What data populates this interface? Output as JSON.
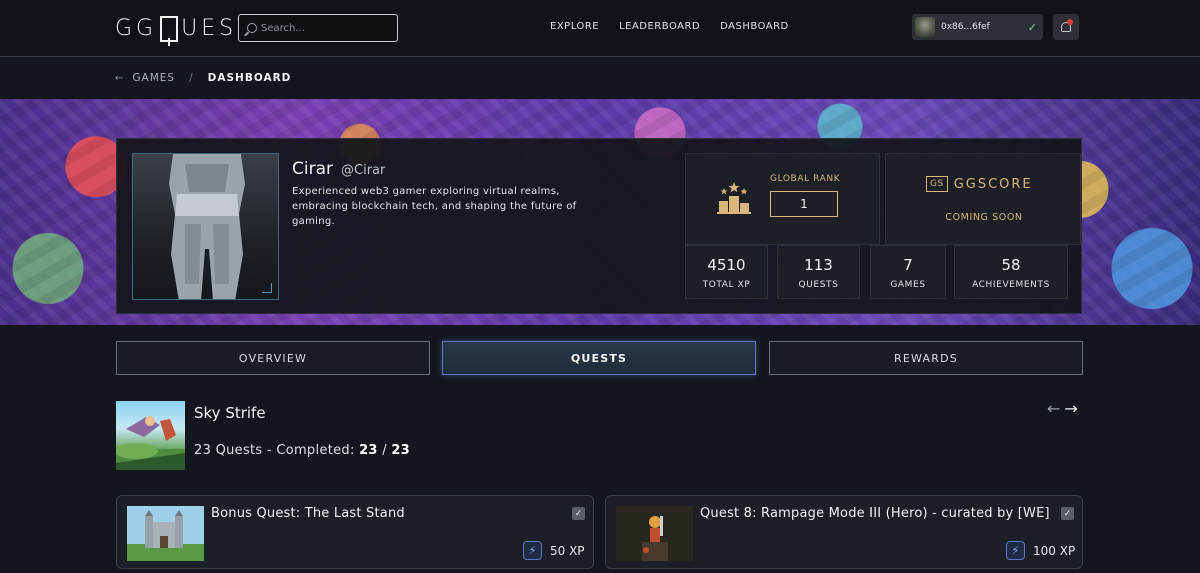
{
  "header": {
    "logo_left": "GG",
    "logo_right": "UEST",
    "search_placeholder": "Search...",
    "nav": [
      "EXPLORE",
      "LEADERBOARD",
      "DASHBOARD"
    ],
    "wallet_address": "0x86...6fef"
  },
  "breadcrumb": {
    "parent": "GAMES",
    "separator": "/",
    "current": "DASHBOARD"
  },
  "profile": {
    "name": "Cirar",
    "handle": "@Cirar",
    "bio": "Experienced web3 gamer exploring virtual realms, embracing blockchain tech, and shaping the future of gaming.",
    "global_rank_label": "GLOBAL RANK",
    "global_rank_value": "1",
    "ggscore_badge": "GS",
    "ggscore_label": "GGSCORE",
    "ggscore_status": "COMING SOON",
    "stats": [
      {
        "value": "4510",
        "label": "TOTAL XP"
      },
      {
        "value": "113",
        "label": "QUESTS"
      },
      {
        "value": "7",
        "label": "GAMES"
      },
      {
        "value": "58",
        "label": "ACHIEVEMENTS"
      }
    ]
  },
  "tabs": [
    {
      "label": "OVERVIEW",
      "active": false
    },
    {
      "label": "QUESTS",
      "active": true
    },
    {
      "label": "REWARDS",
      "active": false
    }
  ],
  "game": {
    "title": "Sky Strife",
    "progress_prefix": "23 Quests - Completed: ",
    "completed": "23",
    "progress_sep": " / ",
    "total": "23",
    "arrow_prev": "←",
    "arrow_next": "→"
  },
  "quests": [
    {
      "title": "Bonus Quest: The Last Stand",
      "xp": "50 XP",
      "completed": true
    },
    {
      "title": "Quest 8: Rampage Mode III (Hero) - curated by [WE]",
      "xp": "100 XP",
      "completed": true
    }
  ],
  "colors": {
    "accent_gold": "#d9b679",
    "accent_blue": "#5a79c8",
    "background": "#13161c"
  }
}
